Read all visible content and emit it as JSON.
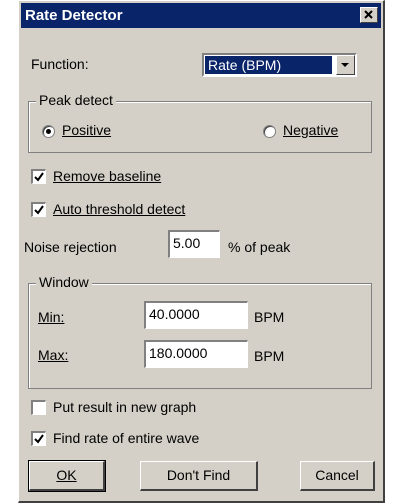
{
  "window": {
    "title": "Rate Detector"
  },
  "function": {
    "label": "Function:",
    "value": "Rate (BPM)"
  },
  "peak_detect": {
    "legend": "Peak detect",
    "positive_label": "Positive",
    "negative_label": "Negative",
    "selected": "Positive"
  },
  "options": {
    "remove_baseline_label": "Remove baseline",
    "remove_baseline_checked": true,
    "auto_threshold_label": "Auto threshold detect",
    "auto_threshold_checked": true
  },
  "noise": {
    "label": "Noise rejection",
    "value": "5.00",
    "unit": "% of peak"
  },
  "window_group": {
    "legend": "Window",
    "min_label": "Min:",
    "min_value": "40.0000",
    "max_label": "Max:",
    "max_value": "180.0000",
    "unit": "BPM"
  },
  "result": {
    "new_graph_label": "Put result in new graph",
    "new_graph_checked": false,
    "entire_wave_label": "Find rate of entire wave",
    "entire_wave_checked": true
  },
  "buttons": {
    "ok": "OK",
    "dont_find": "Don't Find",
    "cancel": "Cancel"
  }
}
